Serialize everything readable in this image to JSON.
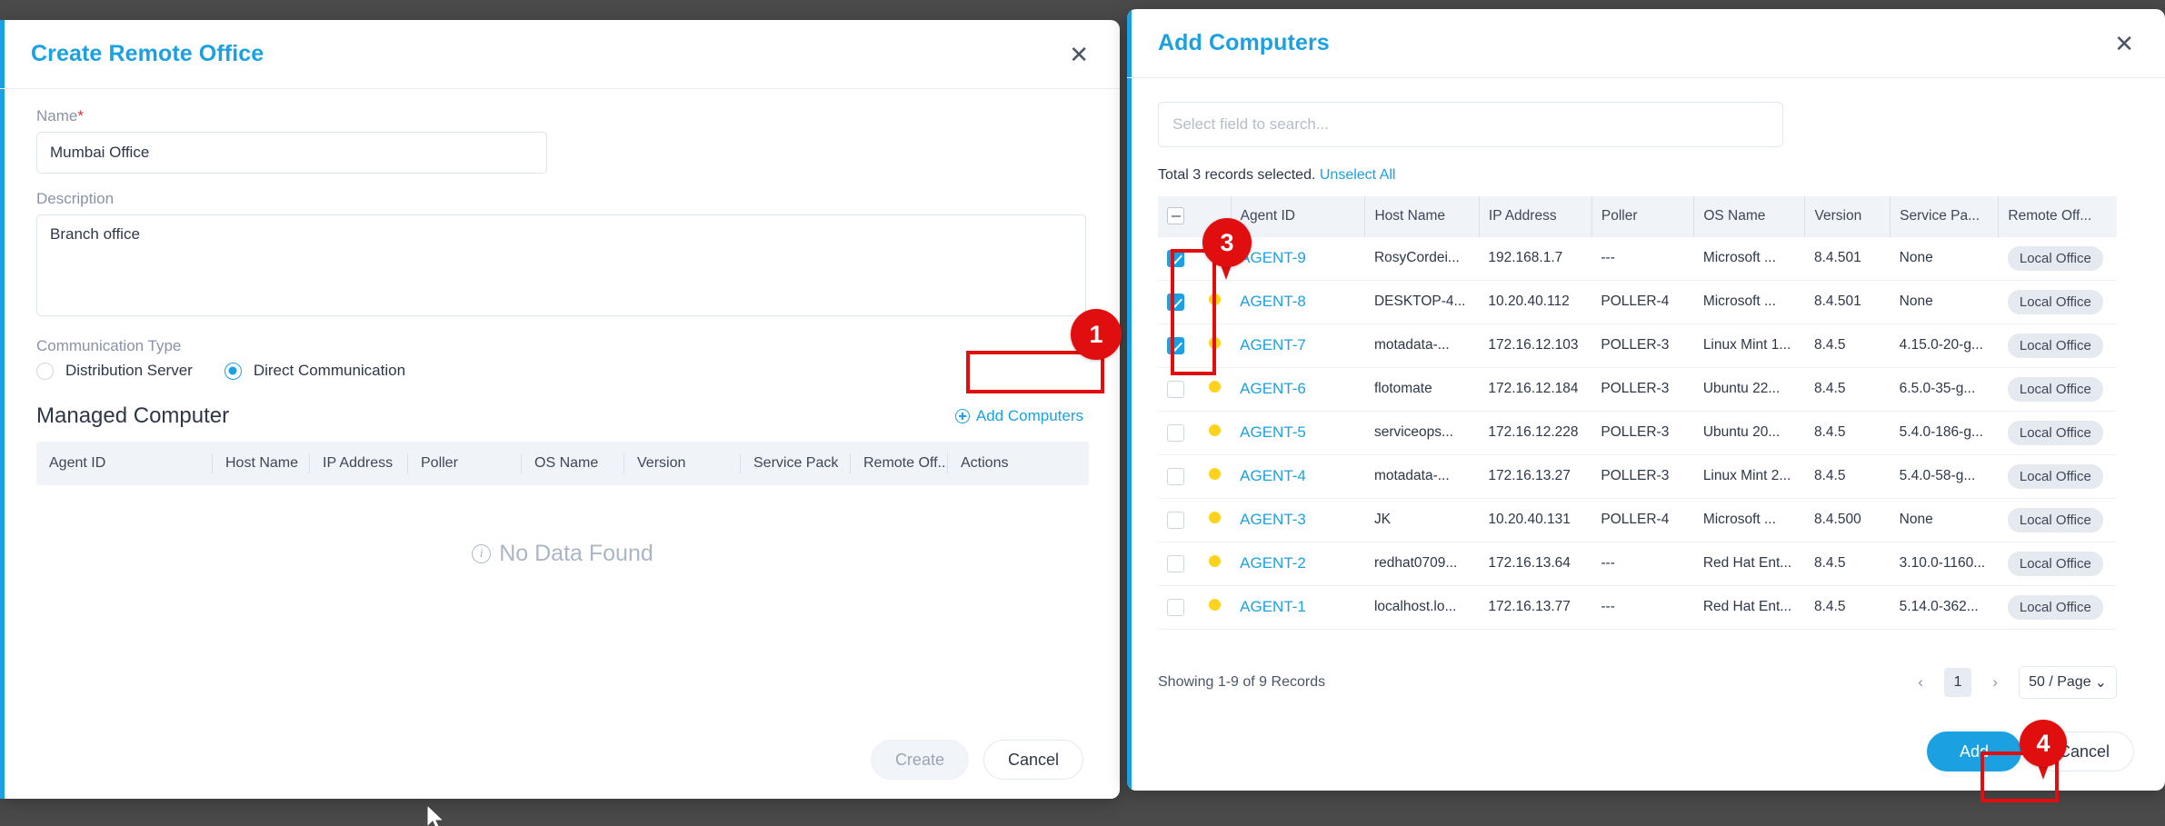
{
  "left_dialog": {
    "title": "Create Remote Office",
    "close_icon": "close-icon",
    "name": {
      "label": "Name",
      "required_mark": "*",
      "value": "Mumbai Office",
      "placeholder": ""
    },
    "description": {
      "label": "Description",
      "value": "Branch office",
      "placeholder": ""
    },
    "communication_type": {
      "label": "Communication Type",
      "options": [
        {
          "label": "Distribution Server",
          "selected": false
        },
        {
          "label": "Direct Communication",
          "selected": true
        }
      ]
    },
    "managed_computer": {
      "section_title": "Managed Computer",
      "add_button_label": "Add Computers",
      "add_button_icon": "plus-circle-icon",
      "columns": [
        "Agent ID",
        "Host Name",
        "IP Address",
        "Poller",
        "OS Name",
        "Version",
        "Service Pack",
        "Remote Off...",
        "Actions"
      ],
      "empty_text": "No Data Found",
      "empty_icon": "info-icon"
    },
    "footer": {
      "create_label": "Create",
      "cancel_label": "Cancel"
    }
  },
  "right_dialog": {
    "title": "Add Computers",
    "close_icon": "close-icon",
    "search": {
      "placeholder": "Select field to search...",
      "value": ""
    },
    "selection_info": {
      "text": "Total 3 records selected.",
      "unselect_all_label": "Unselect All"
    },
    "table": {
      "header_checkbox_state": "indeterminate",
      "columns": [
        "Agent ID",
        "Host Name",
        "IP Address",
        "Poller",
        "OS Name",
        "Version",
        "Service Pa...",
        "Remote Off..."
      ],
      "rows": [
        {
          "checked": true,
          "status": "yellow",
          "agent_id": "AGENT-9",
          "host_name": "RosyCordei...",
          "ip_address": "192.168.1.7",
          "poller": "---",
          "os_name": "Microsoft ...",
          "version": "8.4.501",
          "service_pack": "None",
          "remote_office": "Local Office"
        },
        {
          "checked": true,
          "status": "yellow",
          "agent_id": "AGENT-8",
          "host_name": "DESKTOP-4...",
          "ip_address": "10.20.40.112",
          "poller": "POLLER-4",
          "os_name": "Microsoft ...",
          "version": "8.4.501",
          "service_pack": "None",
          "remote_office": "Local Office"
        },
        {
          "checked": true,
          "status": "yellow",
          "agent_id": "AGENT-7",
          "host_name": "motadata-...",
          "ip_address": "172.16.12.103",
          "poller": "POLLER-3",
          "os_name": "Linux Mint 1...",
          "version": "8.4.5",
          "service_pack": "4.15.0-20-g...",
          "remote_office": "Local Office"
        },
        {
          "checked": false,
          "status": "yellow",
          "agent_id": "AGENT-6",
          "host_name": "flotomate",
          "ip_address": "172.16.12.184",
          "poller": "POLLER-3",
          "os_name": "Ubuntu 22...",
          "version": "8.4.5",
          "service_pack": "6.5.0-35-g...",
          "remote_office": "Local Office"
        },
        {
          "checked": false,
          "status": "yellow",
          "agent_id": "AGENT-5",
          "host_name": "serviceops...",
          "ip_address": "172.16.12.228",
          "poller": "POLLER-3",
          "os_name": "Ubuntu 20...",
          "version": "8.4.5",
          "service_pack": "5.4.0-186-g...",
          "remote_office": "Local Office"
        },
        {
          "checked": false,
          "status": "yellow",
          "agent_id": "AGENT-4",
          "host_name": "motadata-...",
          "ip_address": "172.16.13.27",
          "poller": "POLLER-3",
          "os_name": "Linux Mint 2...",
          "version": "8.4.5",
          "service_pack": "5.4.0-58-g...",
          "remote_office": "Local Office"
        },
        {
          "checked": false,
          "status": "yellow",
          "agent_id": "AGENT-3",
          "host_name": "JK",
          "ip_address": "10.20.40.131",
          "poller": "POLLER-4",
          "os_name": "Microsoft ...",
          "version": "8.4.500",
          "service_pack": "None",
          "remote_office": "Local Office"
        },
        {
          "checked": false,
          "status": "yellow",
          "agent_id": "AGENT-2",
          "host_name": "redhat0709...",
          "ip_address": "172.16.13.64",
          "poller": "---",
          "os_name": "Red Hat Ent...",
          "version": "8.4.5",
          "service_pack": "3.10.0-1160...",
          "remote_office": "Local Office"
        },
        {
          "checked": false,
          "status": "yellow",
          "agent_id": "AGENT-1",
          "host_name": "localhost.lo...",
          "ip_address": "172.16.13.77",
          "poller": "---",
          "os_name": "Red Hat Ent...",
          "version": "8.4.5",
          "service_pack": "5.14.0-362...",
          "remote_office": "Local Office"
        }
      ]
    },
    "pagination": {
      "showing_text": "Showing 1-9 of 9 Records",
      "prev_icon": "chevron-left-icon",
      "next_icon": "chevron-right-icon",
      "current_page": "1",
      "per_page_label": "50 / Page",
      "per_page_icon": "chevron-down-icon"
    },
    "footer": {
      "add_label": "Add",
      "cancel_label": "Cancel"
    }
  },
  "annotations": [
    {
      "number": "1"
    },
    {
      "number": "3"
    },
    {
      "number": "4"
    }
  ],
  "colors": {
    "accent": "#1ba1e2",
    "annotation": "#e10e10",
    "status_dot": "#ffd21e",
    "backdrop": "#4a4a4a"
  }
}
